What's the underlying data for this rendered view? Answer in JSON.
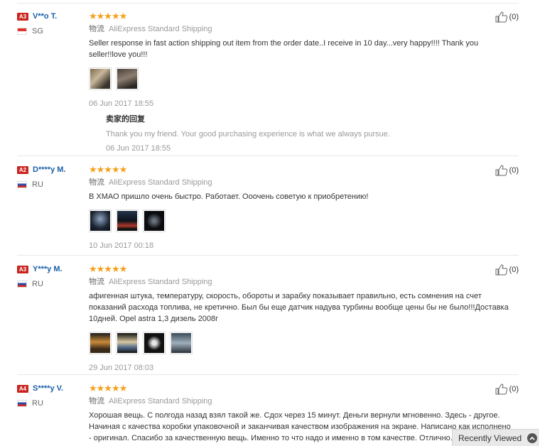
{
  "reviews": [
    {
      "level": "A3",
      "name": "V**o T.",
      "country": "SG",
      "flag": "sg",
      "stars": "★★★★★",
      "ship_label": "物流",
      "shipping": "AliExpress Standard Shipping",
      "comment": "Seller response in fast action shipping out item from the order date..I receive in 10 day...very happy!!!! Thank you seller!!love you!!!",
      "photos": 2,
      "date": "06 Jun 2017 18:55",
      "helpful": "(0)",
      "reply": {
        "title": "卖家的回复",
        "text": "Thank you my friend. Your good purchasing experience is what we always pursue.",
        "date": "06 Jun 2017 18:55"
      }
    },
    {
      "level": "A2",
      "name": "D****y M.",
      "country": "RU",
      "flag": "ru",
      "stars": "★★★★★",
      "ship_label": "物流",
      "shipping": "AliExpress Standard Shipping",
      "comment": "В ХМАО пришло очень быстро. Работает. Ооочень советую к приобретению!",
      "photos": 3,
      "date": "10 Jun 2017 00:18",
      "helpful": "(0)"
    },
    {
      "level": "A3",
      "name": "Y***y M.",
      "country": "RU",
      "flag": "ru",
      "stars": "★★★★★",
      "ship_label": "物流",
      "shipping": "AliExpress Standard Shipping",
      "comment": "афигенная штука, температуру, скорость, обороты и зарабку показывает правильно, есть сомнения на счет показаний расхода топлива, не кретично. Был бы еще датчик надува турбины вообще цены бы не было!!!Доставка 10дней. Opel astra 1,3 дизель 2008г",
      "photos": 4,
      "date": "29 Jun 2017 08:03",
      "helpful": "(0)"
    },
    {
      "level": "A4",
      "name": "S****y V.",
      "country": "RU",
      "flag": "ru",
      "stars": "★★★★★",
      "ship_label": "物流",
      "shipping": "AliExpress Standard Shipping",
      "comment": "Хорошая вещь. С полгода назад взял такой же. Сдох через 15 минут. Деньги вернули мгновенно. Здесь - другое. Начиная с качества коробки упаковочной и заканчивая качеством изображения на экране. Написано как исполнено - оригинал. Спасибо за качественную вещь. Именно то что надо и именно в том качестве. Отлично.",
      "photos": 0,
      "date": "",
      "helpful": "(0)"
    }
  ],
  "recently_viewed": "Recently Viewed"
}
